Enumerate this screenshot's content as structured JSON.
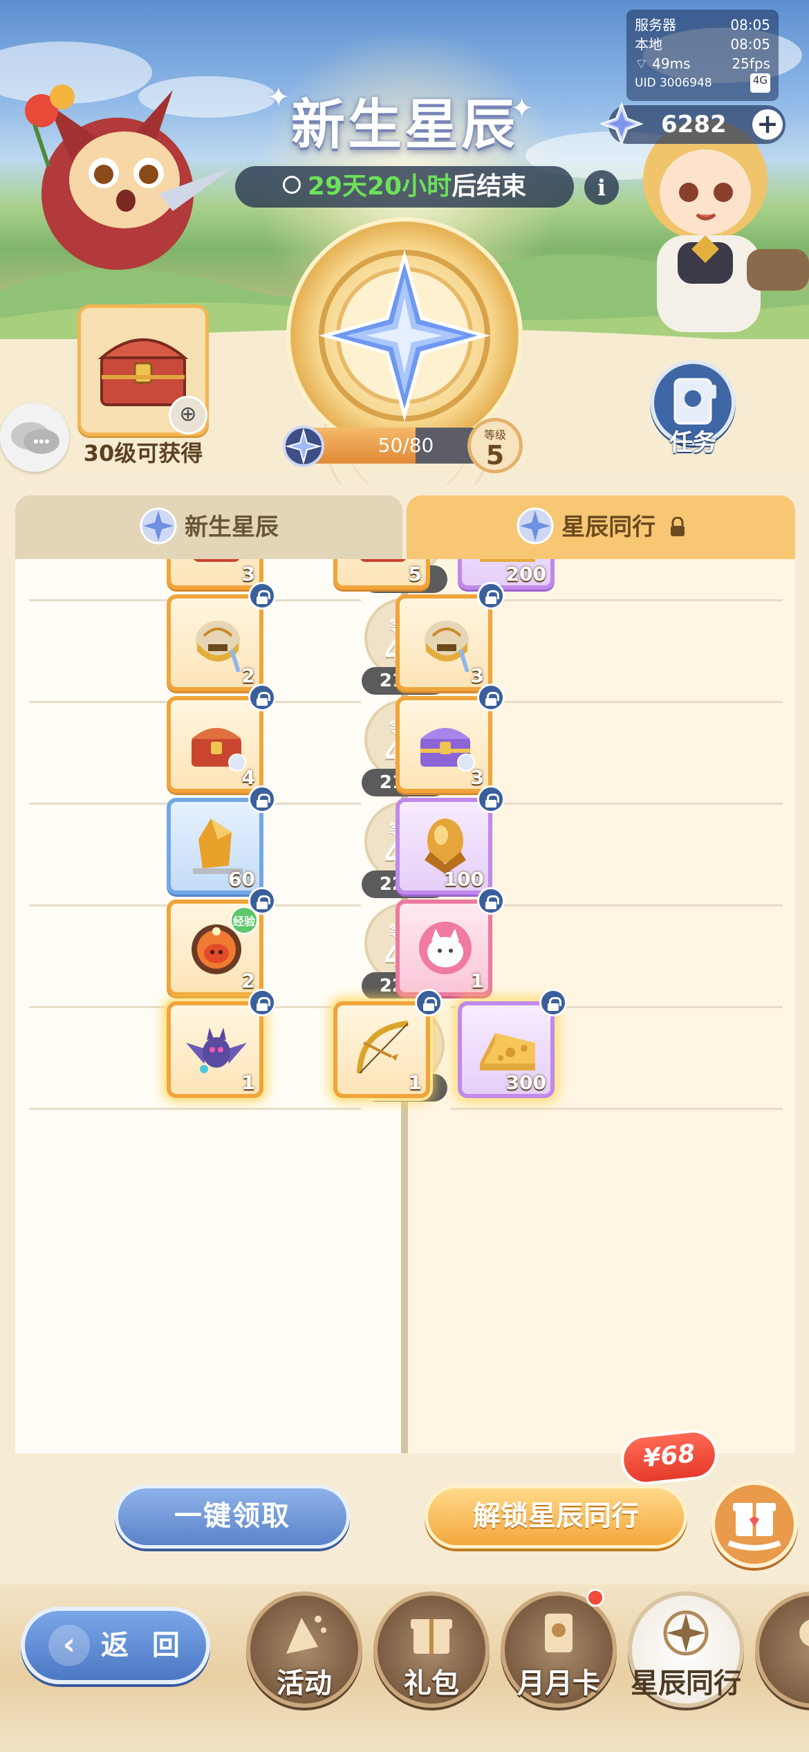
{
  "server": {
    "server_label": "服务器",
    "server_time": "08:05",
    "local_label": "本地",
    "local_time": "08:05",
    "ping": "49ms",
    "fps": "25fps",
    "uid": "UID 3006948",
    "signal_badge": "4G"
  },
  "currency": {
    "value": "6282",
    "icon": "star-crystal-icon"
  },
  "event": {
    "title": "新生星辰",
    "timer_prefix": "29天20小时",
    "timer_suffix": "后结束"
  },
  "chest": {
    "caption": "30级可获得"
  },
  "progress": {
    "text": "50/80",
    "current": 50,
    "max": 80,
    "level_label": "等级",
    "level": "5"
  },
  "task": {
    "label": "任务"
  },
  "tabs": {
    "left": "新生星辰",
    "right": "星辰同行"
  },
  "rows": [
    {
      "level_label": "",
      "level": "45",
      "points": "2050",
      "left": [
        {
          "icon": "book-pouch-icon",
          "qty": "3",
          "rarity": "orange",
          "locked": false
        }
      ],
      "right": [
        {
          "icon": "book-pouch-icon",
          "qty": "5",
          "rarity": "orange",
          "locked": false
        },
        {
          "icon": "cheese-icon",
          "qty": "200",
          "rarity": "purple",
          "locked": false
        }
      ]
    },
    {
      "level_label": "等级",
      "level": "46",
      "points": "2100",
      "left": [
        {
          "icon": "helmet-icon",
          "qty": "2",
          "rarity": "orange",
          "locked": true
        }
      ],
      "right": [
        {
          "icon": "helmet-icon",
          "qty": "3",
          "rarity": "orange",
          "locked": true
        }
      ]
    },
    {
      "level_label": "等级",
      "level": "47",
      "points": "2150",
      "left": [
        {
          "icon": "red-chest-icon",
          "qty": "4",
          "rarity": "orange",
          "locked": true
        }
      ],
      "right": [
        {
          "icon": "purple-chest-icon",
          "qty": "3",
          "rarity": "orange",
          "locked": true
        }
      ]
    },
    {
      "level_label": "等级",
      "level": "48",
      "points": "2200",
      "left": [
        {
          "icon": "amber-stone-icon",
          "qty": "60",
          "rarity": "blue",
          "locked": true
        }
      ],
      "right": [
        {
          "icon": "amber-crest-icon",
          "qty": "100",
          "rarity": "purple",
          "locked": true
        }
      ]
    },
    {
      "level_label": "等级",
      "level": "49",
      "points": "2250",
      "left": [
        {
          "icon": "exp-potion-icon",
          "qty": "2",
          "rarity": "orange",
          "locked": true,
          "badge": "经验"
        }
      ],
      "right": [
        {
          "icon": "cat-avatar-icon",
          "qty": "1",
          "rarity": "pink",
          "locked": true
        }
      ]
    },
    {
      "level_label": "等级",
      "level": "50",
      "points": "2300",
      "left": [
        {
          "icon": "bat-pet-icon",
          "qty": "1",
          "rarity": "orange",
          "locked": true,
          "glow": true
        }
      ],
      "right": [
        {
          "icon": "golden-bow-icon",
          "qty": "1",
          "rarity": "orange",
          "locked": true,
          "glow": true
        },
        {
          "icon": "cheese-icon",
          "qty": "300",
          "rarity": "purple",
          "locked": true,
          "glow": true
        }
      ]
    }
  ],
  "actions": {
    "claim_all": "一键领取",
    "unlock": "解锁星辰同行",
    "price": "¥68"
  },
  "bottom_nav": {
    "back": "返 回",
    "items": [
      {
        "label": "活动",
        "icon": "party-icon",
        "active": false,
        "dot": false
      },
      {
        "label": "礼包",
        "icon": "gift-icon",
        "active": false,
        "dot": false
      },
      {
        "label": "月月卡",
        "icon": "month-card-icon",
        "active": false,
        "dot": true
      },
      {
        "label": "星辰同行",
        "icon": "compass-star-icon",
        "active": true,
        "dot": false
      },
      {
        "label": "",
        "icon": "more-icon",
        "active": false,
        "dot": false
      }
    ]
  }
}
